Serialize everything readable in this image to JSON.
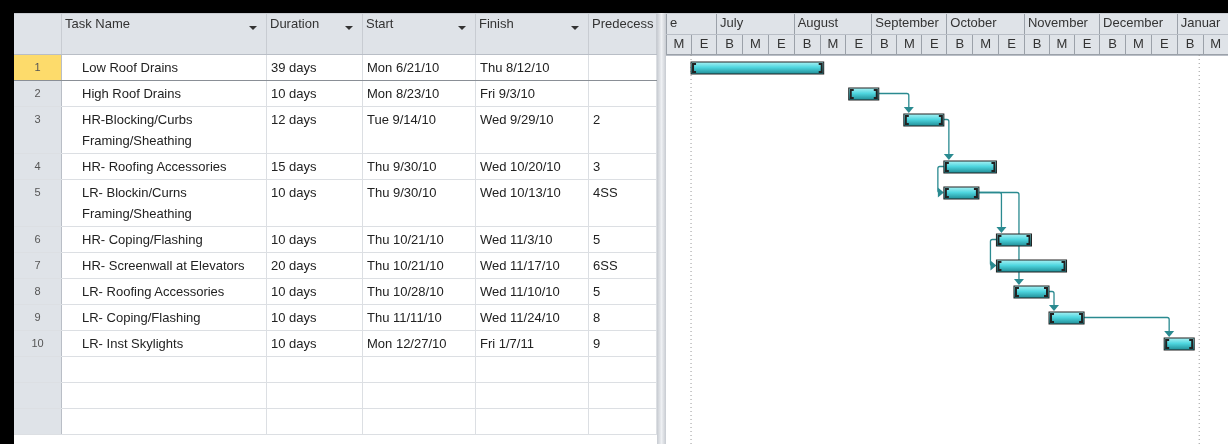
{
  "table": {
    "columns": [
      {
        "label": "Task Name",
        "dropdown": true
      },
      {
        "label": "Duration",
        "dropdown": true
      },
      {
        "label": "Start",
        "dropdown": true
      },
      {
        "label": "Finish",
        "dropdown": true
      },
      {
        "label": "Predecess",
        "dropdown": false
      }
    ],
    "rows": [
      {
        "id": "1",
        "name": "Low Roof Drains",
        "duration": "39 days",
        "start": "Mon 6/21/10",
        "finish": "Thu 8/12/10",
        "selected": true
      },
      {
        "id": "2",
        "name": "High Roof Drains",
        "duration": "10 days",
        "start": "Mon 8/23/10",
        "finish": "Fri 9/3/10",
        "selected": false
      },
      {
        "id": "3",
        "name": "HR-Blocking/Curbs Framing/Sheathing",
        "duration": "12 days",
        "start": "Tue 9/14/10",
        "finish": "Wed 9/29/10",
        "predecessors": "2",
        "selected": false
      },
      {
        "id": "4",
        "name": "HR- Roofing Accessories",
        "duration": "15 days",
        "start": "Thu 9/30/10",
        "finish": "Wed 10/20/10",
        "predecessors": "3",
        "selected": false
      },
      {
        "id": "5",
        "name": "LR- Blockin/Curns Framing/Sheathing",
        "duration": "10 days",
        "start": "Thu 9/30/10",
        "finish": "Wed 10/13/10",
        "predecessors": "4SS",
        "selected": false
      },
      {
        "id": "6",
        "name": "HR- Coping/Flashing",
        "duration": "10 days",
        "start": "Thu 10/21/10",
        "finish": "Wed 11/3/10",
        "predecessors": "5",
        "selected": false
      },
      {
        "id": "7",
        "name": "HR- Screenwall at Elevators",
        "duration": "20 days",
        "start": "Thu 10/21/10",
        "finish": "Wed 11/17/10",
        "predecessors": "6SS",
        "selected": false
      },
      {
        "id": "8",
        "name": "LR- Roofing Accessories",
        "duration": "10 days",
        "start": "Thu 10/28/10",
        "finish": "Wed 11/10/10",
        "predecessors": "5",
        "selected": false
      },
      {
        "id": "9",
        "name": "LR- Coping/Flashing",
        "duration": "10 days",
        "start": "Thu 11/11/10",
        "finish": "Wed 11/24/10",
        "predecessors": "8",
        "selected": false
      },
      {
        "id": "10",
        "name": "LR- Inst Skylights",
        "duration": "10 days",
        "start": "Mon 12/27/10",
        "finish": "Fri 1/7/11",
        "predecessors": "9",
        "selected": false
      }
    ]
  },
  "gantt": {
    "months": [
      "e",
      "July",
      "August",
      "September",
      "October",
      "November",
      "December",
      "Januar"
    ],
    "thirds": [
      "M",
      "E",
      "B",
      "M",
      "E",
      "B",
      "M",
      "E",
      "B",
      "M",
      "E",
      "B",
      "M",
      "E",
      "B",
      "M",
      "E",
      "B",
      "M",
      "E",
      "B",
      "M"
    ]
  }
}
